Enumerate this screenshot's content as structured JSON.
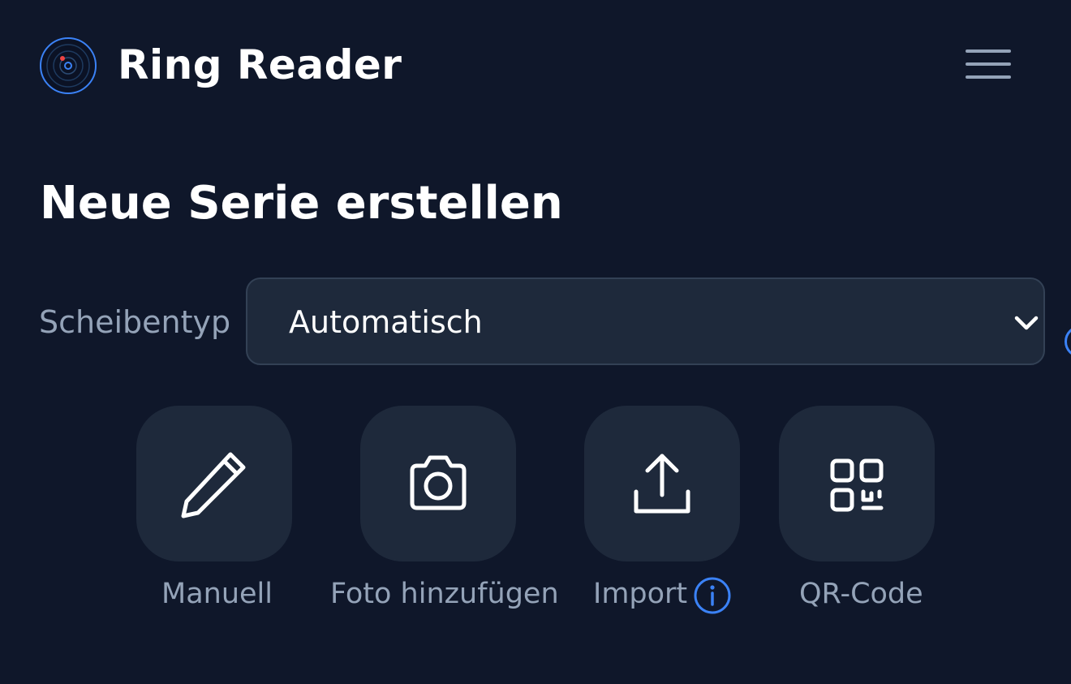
{
  "header": {
    "app_title": "Ring Reader",
    "logo_icon": "target-logo-icon",
    "menu_icon": "hamburger-menu-icon"
  },
  "main": {
    "page_title": "Neue Serie erstellen",
    "target_type": {
      "label": "Scheibentyp",
      "selected_value": "Automatisch",
      "dropdown_icon": "chevron-down-icon"
    },
    "actions": [
      {
        "label": "Manuell",
        "icon": "pencil-icon"
      },
      {
        "label": "Foto hinzufügen",
        "icon": "camera-icon"
      },
      {
        "label": "Import",
        "icon": "upload-icon",
        "info_icon": "info-icon"
      },
      {
        "label": "QR-Code",
        "icon": "qr-code-icon"
      }
    ]
  },
  "colors": {
    "background": "#0f172a",
    "surface": "#1e293b",
    "border": "#334155",
    "muted_text": "#94a3b8",
    "accent": "#3b82f6",
    "logo_dot": "#ef4444"
  }
}
